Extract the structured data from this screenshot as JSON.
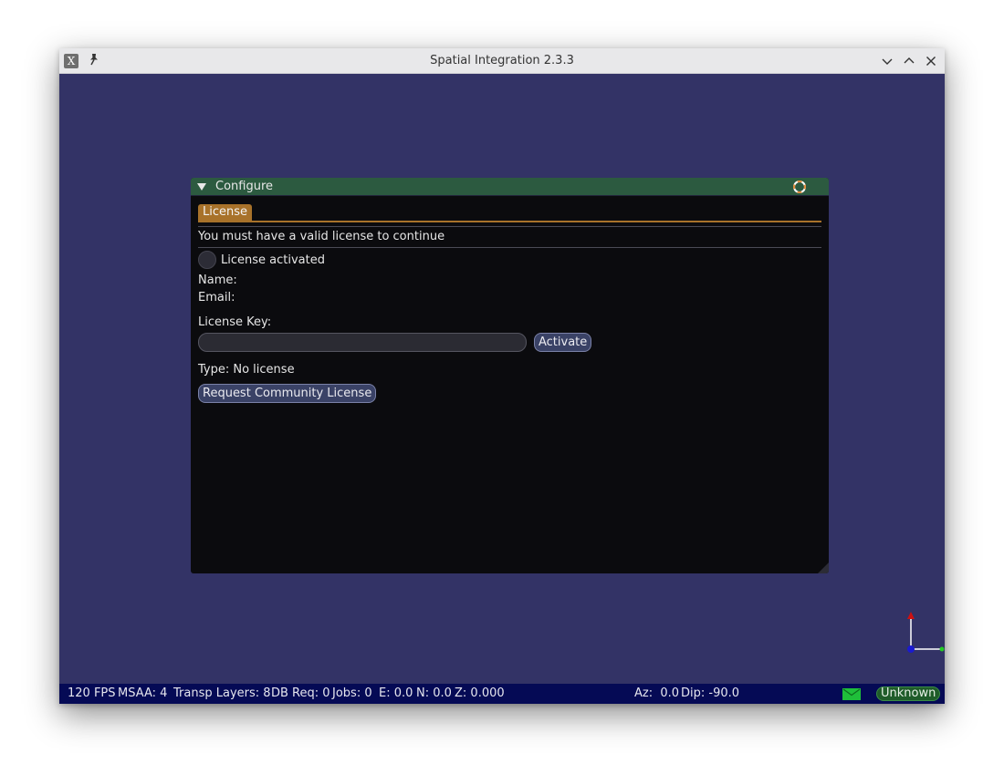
{
  "window": {
    "title": "Spatial Integration 2.3.3",
    "app_icon_glyph": "X",
    "pin_glyph": "📌"
  },
  "panel": {
    "title": "Configure",
    "tabs": [
      {
        "label": "License",
        "active": true
      }
    ],
    "message": "You must have a valid license to continue",
    "license_activated_label": "License activated",
    "license_activated_checked": false,
    "name_label": "Name:",
    "email_label": "Email:",
    "license_key_label": "License Key:",
    "license_key_value": "",
    "activate_label": "Activate",
    "type_text": "Type: No license",
    "request_license_label": "Request Community License"
  },
  "statusbar": {
    "fps": "120 FPS",
    "msaa": "MSAA: 4",
    "transp_layers": "Transp Layers: 8",
    "db_req": "DB Req: 0",
    "jobs": "Jobs: 0",
    "e": "E: 0.0",
    "n": "N: 0.0",
    "z": "Z: 0.000",
    "az": "Az:  0.0",
    "dip": "Dip: -90.0",
    "status": "Unknown"
  },
  "colors": {
    "viewport_bg": "#333366",
    "panel_header": "#2c5a40",
    "tab_accent": "#a8722a",
    "statusbar_bg": "#050a55",
    "status_badge": "#1f5c2a"
  }
}
